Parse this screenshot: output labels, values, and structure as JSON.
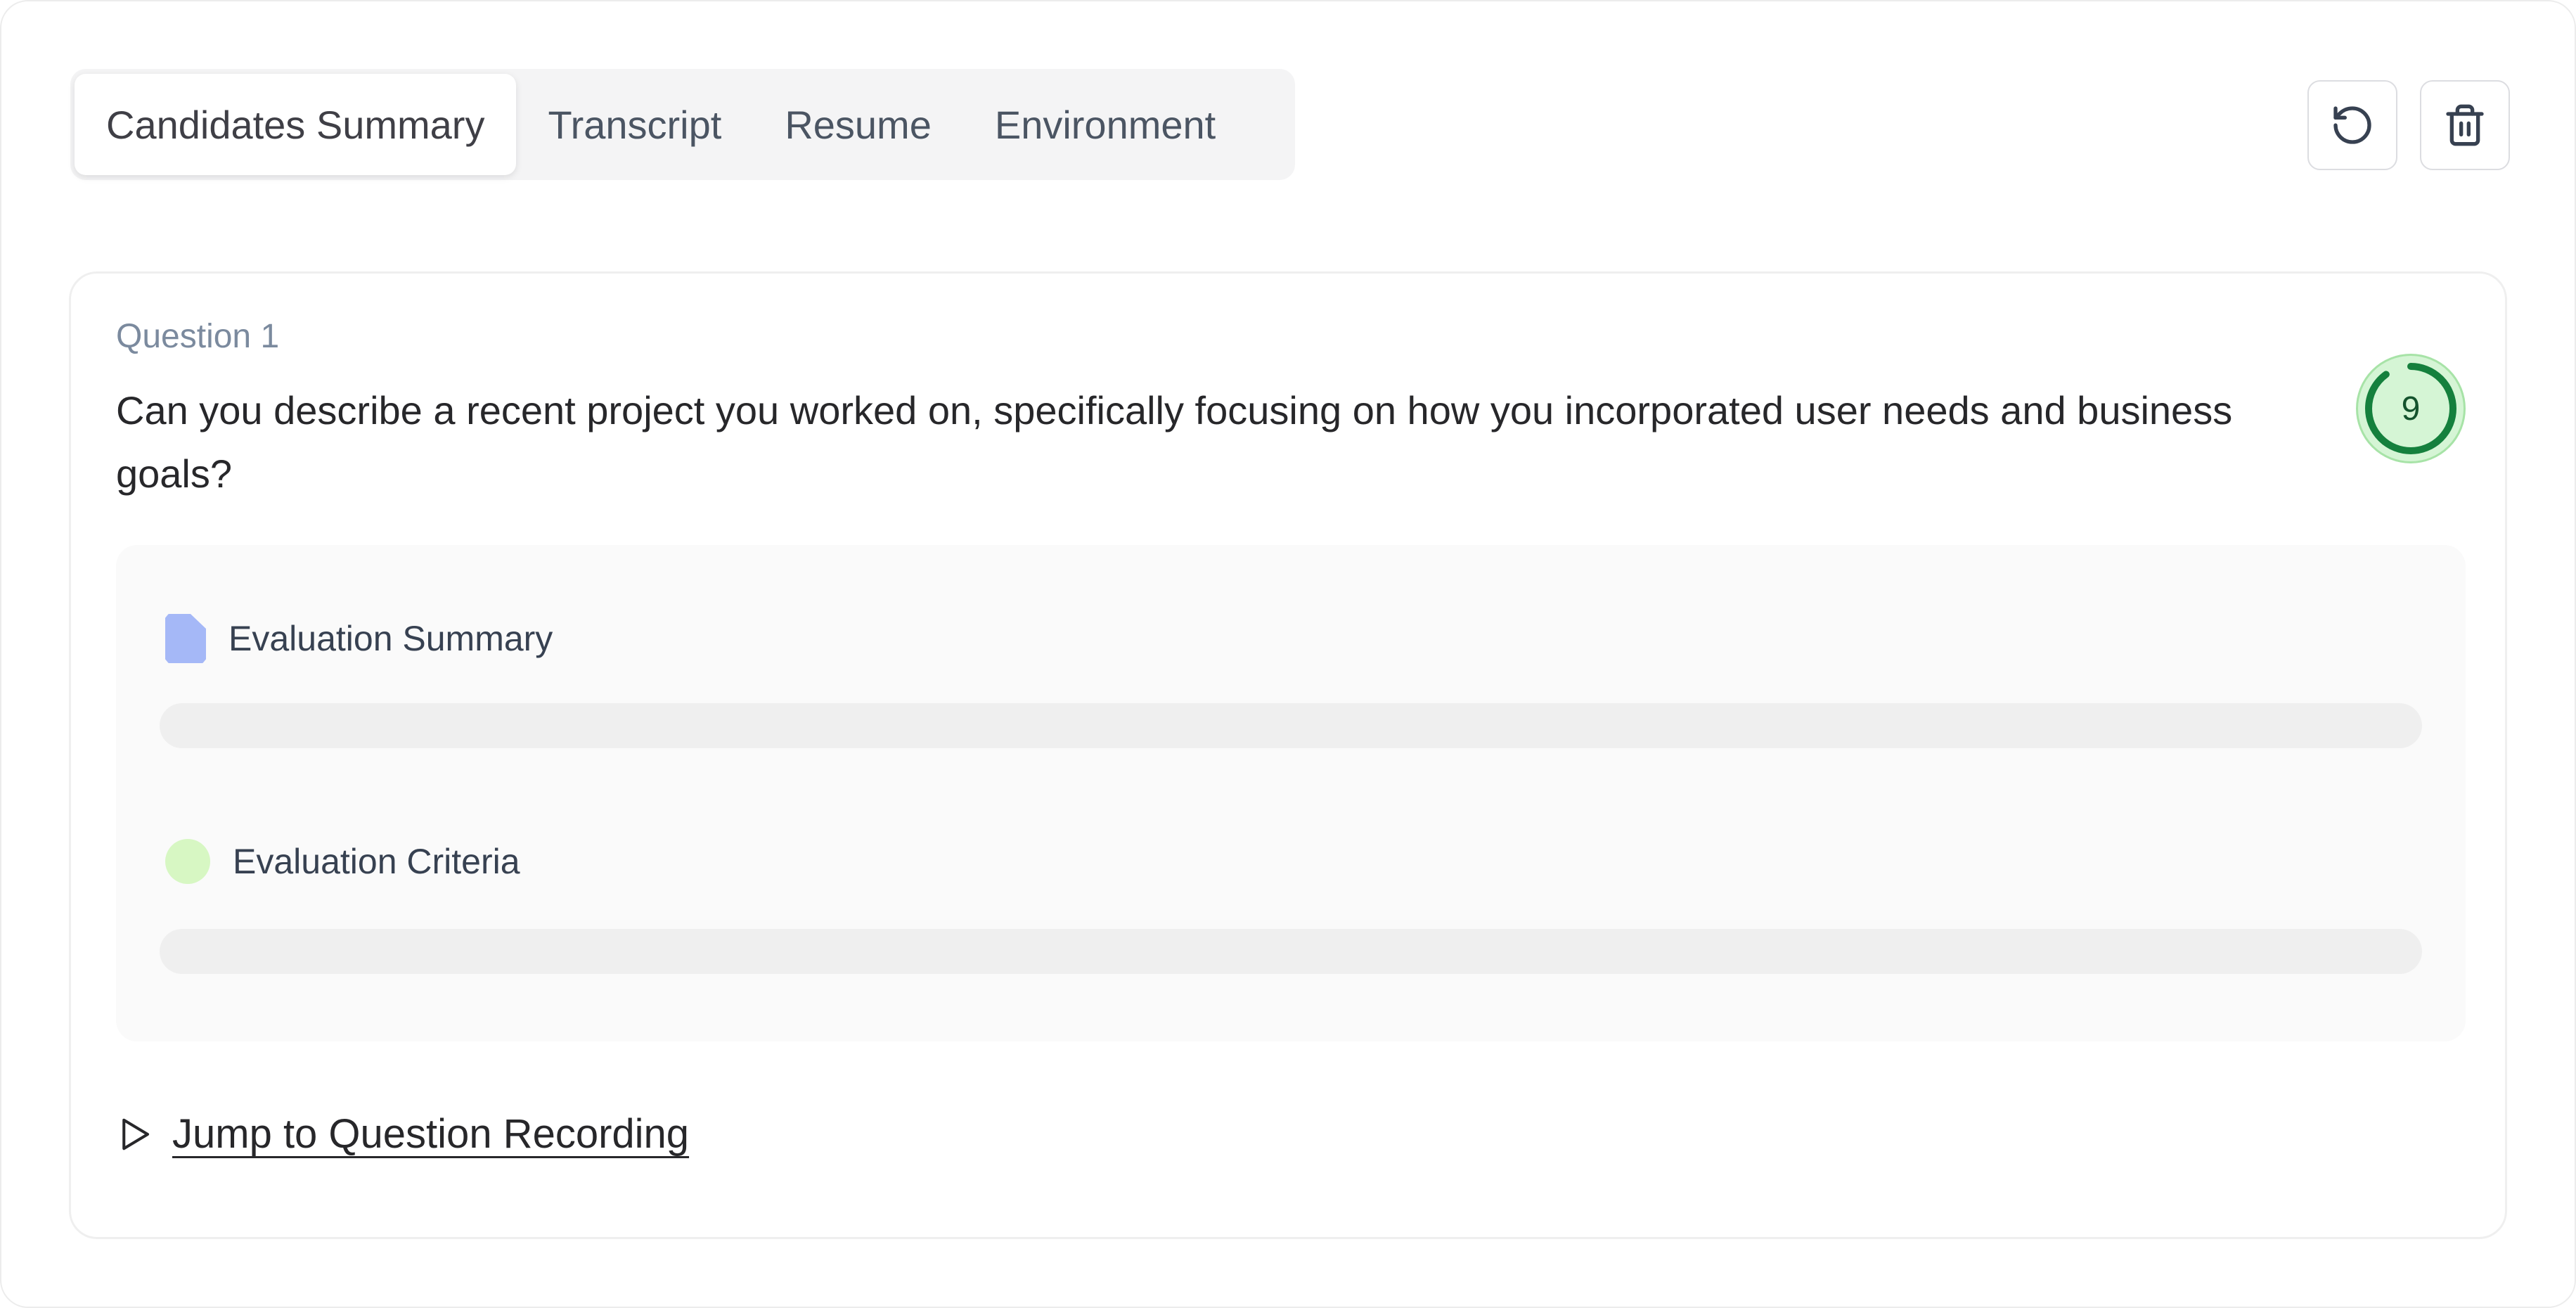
{
  "tabs": [
    {
      "label": "Candidates Summary",
      "active": true
    },
    {
      "label": "Transcript",
      "active": false
    },
    {
      "label": "Resume",
      "active": false
    },
    {
      "label": "Environment",
      "active": false
    }
  ],
  "toolbar": {
    "refresh_icon": "rotate-ccw-icon",
    "delete_icon": "trash-icon"
  },
  "question": {
    "label": "Question 1",
    "text": "Can you describe a recent project you worked on, specifically focusing on how you incorporated user needs and business goals?",
    "score": "9",
    "score_fraction": 0.9,
    "score_color": "#15803d"
  },
  "evaluation": {
    "summary_label": "Evaluation Summary",
    "summary_icon": "document-icon",
    "criteria_label": "Evaluation Criteria",
    "criteria_icon": "dot-icon"
  },
  "actions": {
    "jump_label": "Jump to Question Recording",
    "jump_icon": "play-icon"
  }
}
